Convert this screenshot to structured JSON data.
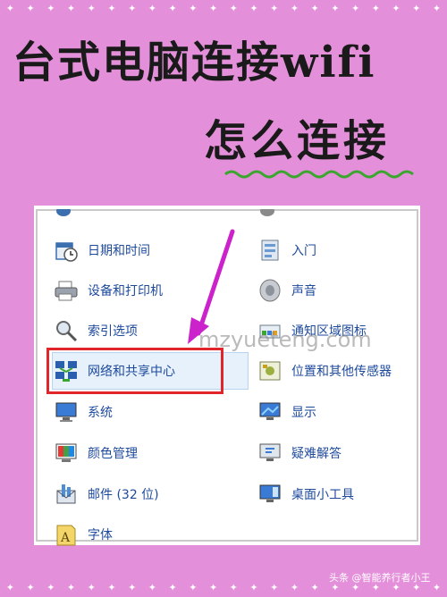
{
  "header": {
    "title_line1": "台式电脑连接wifi",
    "title_line2": "怎么连接"
  },
  "panel": {
    "left_column": [
      {
        "label": "日期和时间",
        "icon": "calendar-clock-icon"
      },
      {
        "label": "设备和打印机",
        "icon": "printer-icon"
      },
      {
        "label": "索引选项",
        "icon": "index-search-icon"
      },
      {
        "label": "网络和共享中心",
        "icon": "network-icon"
      },
      {
        "label": "系统",
        "icon": "system-icon"
      },
      {
        "label": "颜色管理",
        "icon": "color-management-icon"
      },
      {
        "label": "邮件 (32 位)",
        "icon": "mail-icon"
      },
      {
        "label": "字体",
        "icon": "fonts-icon"
      }
    ],
    "right_column": [
      {
        "label": "入门",
        "icon": "getting-started-icon"
      },
      {
        "label": "声音",
        "icon": "speaker-icon"
      },
      {
        "label": "通知区域图标",
        "icon": "notification-icon"
      },
      {
        "label": "位置和其他传感器",
        "icon": "sensor-icon"
      },
      {
        "label": "显示",
        "icon": "display-icon"
      },
      {
        "label": "疑难解答",
        "icon": "troubleshoot-icon"
      },
      {
        "label": "桌面小工具",
        "icon": "gadgets-icon"
      }
    ]
  },
  "watermark": "mzyueteng.com",
  "credit": "头条 @智能养行者小王",
  "colors": {
    "background": "#e38fd9",
    "highlight": "#e0262b",
    "arrow": "#cc22cc",
    "link": "#1e4a9c"
  }
}
